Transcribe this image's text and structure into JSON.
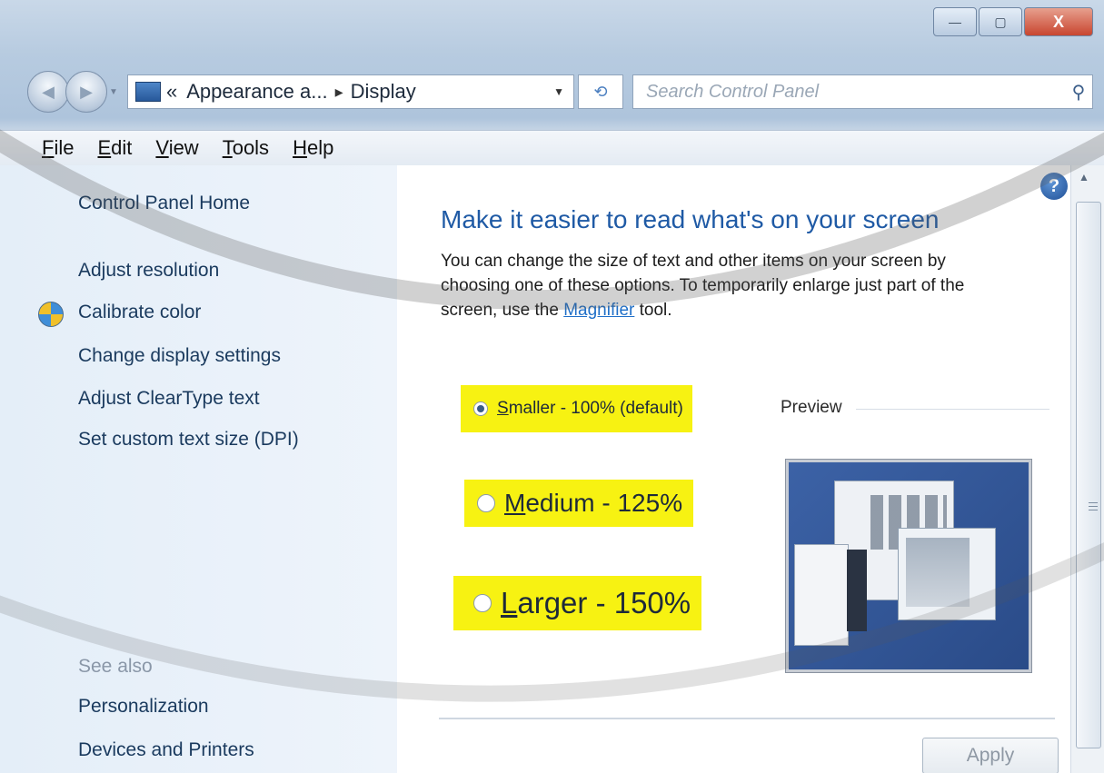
{
  "window": {
    "minimize_glyph": "—",
    "maximize_glyph": "▢",
    "close_glyph": "X"
  },
  "nav": {
    "breadcrumb": [
      {
        "label": "Appearance a..."
      },
      {
        "label": "Display"
      }
    ],
    "crumb_prefix": "«",
    "crumb_separator": "▸",
    "search_placeholder": "Search Control Panel"
  },
  "menu": [
    {
      "label_pre": "",
      "key": "F",
      "label_post": "ile"
    },
    {
      "label_pre": "",
      "key": "E",
      "label_post": "dit"
    },
    {
      "label_pre": "",
      "key": "V",
      "label_post": "iew"
    },
    {
      "label_pre": "",
      "key": "T",
      "label_post": "ools"
    },
    {
      "label_pre": "",
      "key": "H",
      "label_post": "elp"
    }
  ],
  "sidebar": {
    "items": [
      {
        "label": "Control Panel Home"
      },
      {
        "label": "Adjust resolution"
      },
      {
        "label": "Calibrate color"
      },
      {
        "label": "Change display settings"
      },
      {
        "label": "Adjust ClearType text"
      },
      {
        "label": "Set custom text size (DPI)"
      }
    ],
    "see_also_label": "See also",
    "see_also": [
      {
        "label": "Personalization"
      },
      {
        "label": "Devices and Printers"
      }
    ]
  },
  "main": {
    "title": "Make it easier to read what's on your screen",
    "desc_before": "You can change the size of text and other items on your screen by choosing one of these options. To temporarily enlarge just part of the screen, use the ",
    "desc_link": "Magnifier",
    "desc_after": " tool.",
    "options": [
      {
        "key": "S",
        "rest": "maller - 100% (default)",
        "selected": true
      },
      {
        "key": "M",
        "rest": "edium - 125%",
        "selected": false
      },
      {
        "key": "L",
        "rest": "arger - 150%",
        "selected": false
      }
    ],
    "preview_label": "Preview",
    "apply_label": "Apply"
  },
  "colors": {
    "highlight": "#f7f212",
    "title_blue": "#1f5aa5",
    "link_blue": "#1f6fc8"
  }
}
